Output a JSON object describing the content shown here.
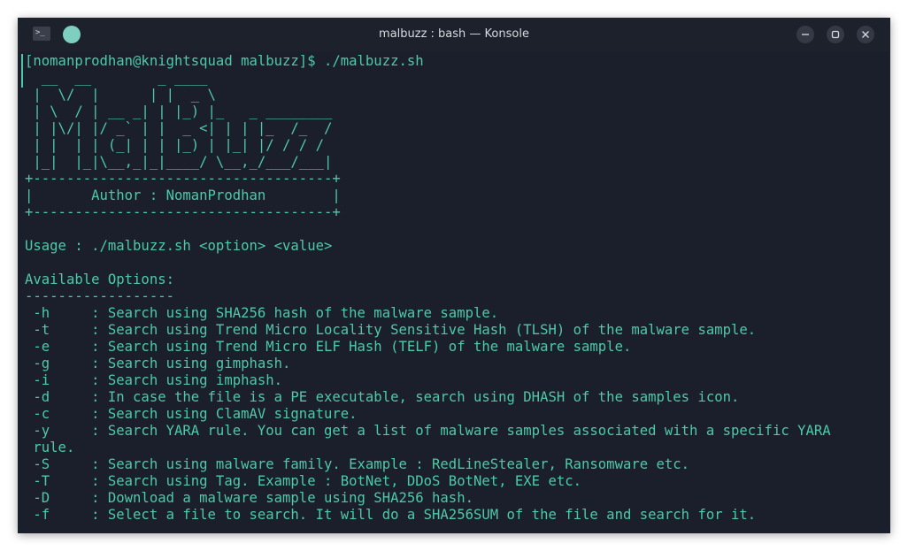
{
  "window": {
    "title": "malbuzz : bash — Konsole",
    "terminal_icon_glyph": ">_",
    "icons": [
      "terminal-icon",
      "pin-icon",
      "minimize-icon",
      "maximize-icon",
      "close-icon"
    ]
  },
  "terminal": {
    "lines": [
      "[nomanprodhan@knightsquad malbuzz]$ ./malbuzz.sh",
      "  __  __        _ ____",
      " |  \\/  |      | |  _ \\",
      " | \\  / | __ _| | |_) |_   _ ________",
      " | |\\/| |/ _` | |  _ <| | | |_  /_  /",
      " | |  | | (_| | | |_) | |_| |/ / / /",
      " |_|  |_|\\__,_|_|____/ \\__,_/___/___|",
      "+------------------------------------+",
      "|       Author : NomanProdhan        |",
      "+------------------------------------+",
      "",
      "Usage : ./malbuzz.sh <option> <value>",
      "",
      "Available Options:",
      "------------------",
      " -h     : Search using SHA256 hash of the malware sample.",
      " -t     : Search using Trend Micro Locality Sensitive Hash (TLSH) of the malware sample.",
      " -e     : Search using Trend Micro ELF Hash (TELF) of the malware sample.",
      " -g     : Search using gimphash.",
      " -i     : Search using imphash.",
      " -d     : In case the file is a PE executable, search using DHASH of the samples icon.",
      " -c     : Search using ClamAV signature.",
      " -y     : Search YARA rule. You can get a list of malware samples associated with a specific YARA",
      " rule.",
      " -S     : Search using malware family. Example : RedLineStealer, Ransomware etc.",
      " -T     : Search using Tag. Example : BotNet, DDoS BotNet, EXE etc.",
      " -D     : Download a malware sample using SHA256 hash.",
      " -f     : Select a file to search. It will do a SHA256SUM of the file and search for it."
    ]
  },
  "colors": {
    "terminal_bg": "#1a1f2b",
    "terminal_text": "#4ec9a8",
    "title_text": "#d6d9df",
    "pin_accent": "#7fcfc0"
  }
}
